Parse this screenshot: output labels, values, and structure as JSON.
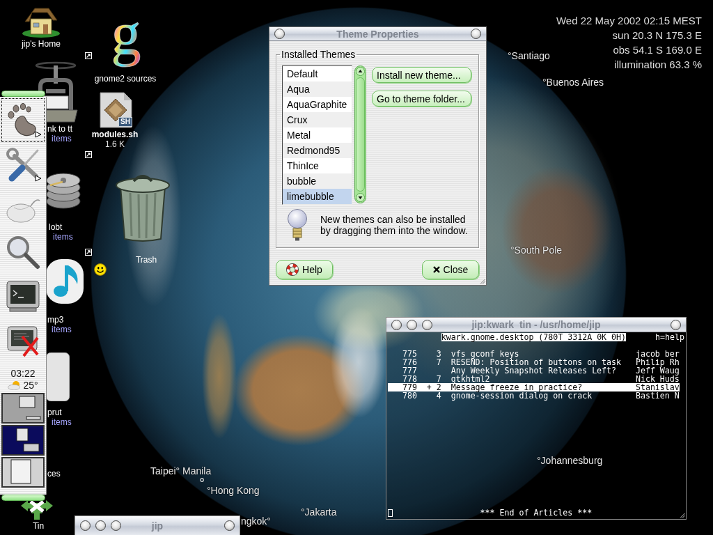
{
  "desktop_info": {
    "lines": [
      "Wed 22 May 2002 02:15 MEST",
      "sun 20.3 N 175.3 E",
      "obs 54.1 S 169.0 E",
      "illumination 63.3 %"
    ]
  },
  "map_labels": [
    "°Santiago",
    "°Buenos Aires",
    "°South Pole",
    "°Johannesburg",
    "Taipei°",
    "Manila",
    "°Hong Kong",
    "°Jakarta",
    "ngkok°"
  ],
  "desktop_icons": [
    {
      "kind": "house",
      "label": "jip's Home"
    },
    {
      "kind": "logo",
      "logo_text": "g",
      "label": "gnome2 sources"
    },
    {
      "kind": "press",
      "label": "nk to tt",
      "sublabel": "items"
    },
    {
      "kind": "script",
      "badge": "SH",
      "label": "modules.sh",
      "sublabel": "1.6 K"
    },
    {
      "kind": "disks",
      "label": "lobt",
      "sublabel": "items"
    },
    {
      "kind": "trash",
      "label": "Trash"
    },
    {
      "kind": "music",
      "label": "mp3",
      "sublabel": "items"
    },
    {
      "kind": "document",
      "label": "prut",
      "sublabel": "items"
    },
    {
      "kind": "places",
      "label": "ces"
    },
    {
      "kind": "transfer",
      "label": "Tin"
    }
  ],
  "panel": {
    "launchers": [
      {
        "kind": "foot",
        "has_menu": true,
        "focused": true
      },
      {
        "kind": "tools",
        "has_menu": true,
        "focused": false
      },
      {
        "kind": "mouse",
        "has_menu": false,
        "focused": false
      },
      {
        "kind": "magnifier",
        "has_menu": false,
        "focused": false
      },
      {
        "kind": "terminal",
        "has_menu": false,
        "focused": false
      },
      {
        "kind": "terminal_off",
        "has_menu": false,
        "focused": false
      }
    ],
    "clock": "03:22",
    "weather": "25°",
    "workspaces": [
      {
        "selected": false
      },
      {
        "selected": true
      },
      {
        "selected": false
      }
    ]
  },
  "theme_dialog": {
    "title": "Theme Properties",
    "group_label": "Installed Themes",
    "themes": [
      {
        "name": "Default",
        "selected": false
      },
      {
        "name": "Aqua",
        "selected": false
      },
      {
        "name": "AquaGraphite",
        "selected": false
      },
      {
        "name": "Crux",
        "selected": false
      },
      {
        "name": "Metal",
        "selected": false
      },
      {
        "name": "Redmond95",
        "selected": false
      },
      {
        "name": "ThinIce",
        "selected": false
      },
      {
        "name": "bubble",
        "selected": false
      },
      {
        "name": "limebubble",
        "selected": true
      }
    ],
    "buttons": [
      "Install new theme...",
      "Go to theme folder..."
    ],
    "hint": "New themes can also be installed by dragging them into the window.",
    "help_button": "Help",
    "close_button": "Close"
  },
  "terminal": {
    "title": "jip:kwark  tin - /usr/home/jip",
    "header": "kwark.gnome.desktop (780T 3312A 0K 0H)",
    "help": "h=help",
    "articles": [
      {
        "number": "775",
        "count": "3",
        "subject": "vfs gconf keys",
        "author": "jacob ber",
        "selected": false
      },
      {
        "number": "776",
        "count": "7",
        "subject": "RESEND: Position of buttons on task",
        "author": "Philip Rh",
        "selected": false
      },
      {
        "number": "777",
        "subject": "Any Weekly Snapshot Releases Left?",
        "author": "Jeff Waug",
        "selected": false
      },
      {
        "number": "778",
        "count": "7",
        "subject": "gtkhtml2",
        "author": "Nick Huds",
        "selected": false
      },
      {
        "number": "779",
        "count": "+ 2",
        "subject": "Message freeze in practice?",
        "author": "Stanislav",
        "selected": true
      },
      {
        "number": "780",
        "count": "4",
        "subject": "gnome-session dialog on crack",
        "author": "Bastien N",
        "selected": false
      }
    ],
    "footer": "*** End of Articles ***"
  },
  "jip_window": {
    "title": "jip"
  }
}
